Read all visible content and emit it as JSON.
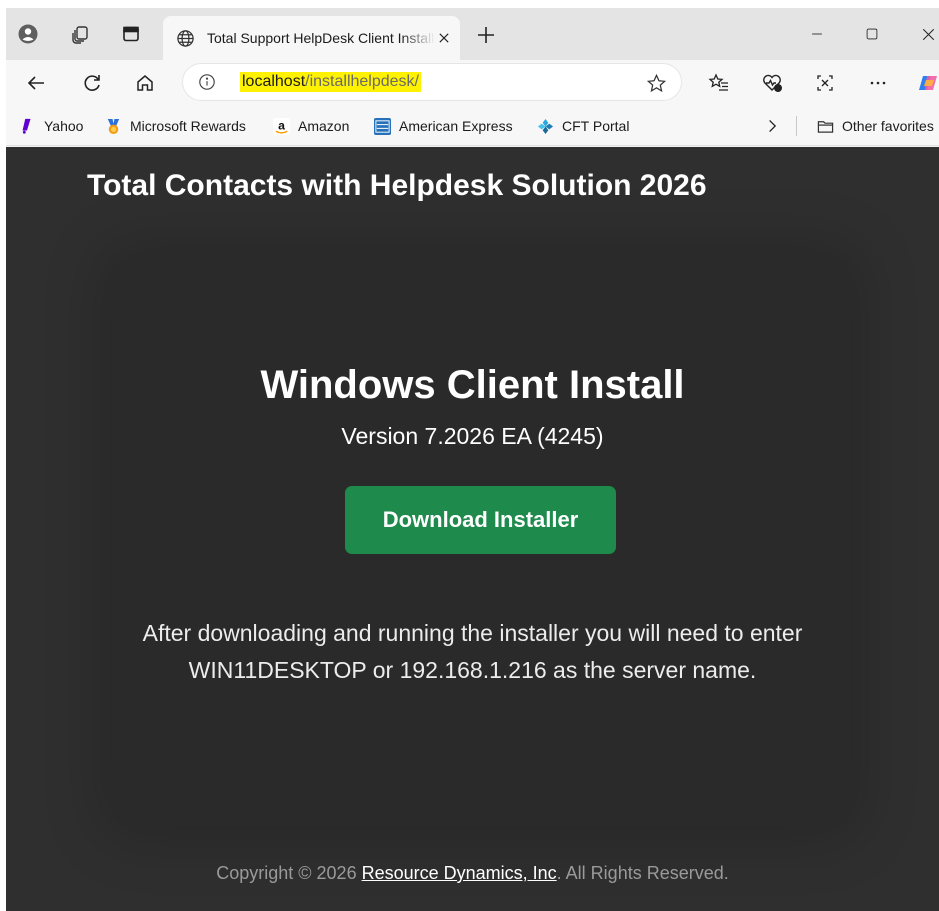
{
  "browser": {
    "tab": {
      "title": "Total Support HelpDesk Client Install",
      "close_icon": "close-icon"
    },
    "address_bar": {
      "url_host": "localhost",
      "url_path": "/installhelpdesk/"
    },
    "favorites": [
      {
        "label": "Yahoo",
        "icon": "yahoo-icon"
      },
      {
        "label": "Microsoft Rewards",
        "icon": "rewards-icon"
      },
      {
        "label": "Amazon",
        "icon": "amazon-icon"
      },
      {
        "label": "American Express",
        "icon": "amex-icon"
      },
      {
        "label": "CFT Portal",
        "icon": "cft-icon"
      }
    ],
    "other_favorites": "Other favorites"
  },
  "page": {
    "header": "Total Contacts with Helpdesk Solution 2026",
    "title": "Windows Client Install",
    "version": "Version 7.2026 EA (4245)",
    "download_label": "Download Installer",
    "instructions_line1": "After downloading and running the installer you will need to enter",
    "instructions_line2": "WIN11DESKTOP or 192.168.1.216 as the server name.",
    "footer_prefix": "Copyright © 2026 ",
    "footer_link": "Resource Dynamics, Inc",
    "footer_suffix": ". All Rights Reserved."
  },
  "colors": {
    "page_bg": "#2f2f2f",
    "card_bg": "#2a2a2a",
    "button_green": "#1e8a4c",
    "url_highlight": "#fff200"
  }
}
